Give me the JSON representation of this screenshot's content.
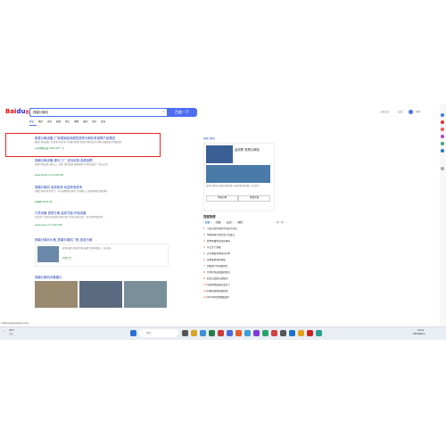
{
  "header": {
    "logo_text": "Bai",
    "logo_du": "du",
    "logo_suffix": "百度",
    "query": "铁磨分离机",
    "search_button": "百度一下",
    "top_links": [
      "百度首页",
      "设置",
      "小",
      "秋秋"
    ]
  },
  "tabs": [
    "网页",
    "图片",
    "资讯",
    "视频",
    "笔记",
    "地图",
    "贴吧",
    "文库",
    "更多"
  ],
  "results": [
    {
      "title": "磁铁分离设备_厂家直销高效磁性铁质分离机有保障产品原因",
      "desc": "磁铁分离设备厂家直销,专业生产各类分离机,铁质分离机选型咨询,质量保障,价格优惠...",
      "source": "兴海电器设备 2024-06",
      "tag": "广告"
    },
    {
      "title": "铁磨分离设备-源头工厂-支持定制-品质保障",
      "desc": "铁磨分离设备,源头工厂直供,支持定制,品质保障,专业研发生产,售后无忧...",
      "source": "www.fenliji.com 2024-06"
    },
    {
      "title": "铁磨分离机 高效除铁 欢迎来电咨询",
      "desc": "铁磨分离机专业生产厂家,高效除铁,适用于各类矿石,欢迎来电咨询选购...",
      "source": "机械网 2024-06"
    },
    {
      "title": "口意设备 铁质分离 高效节能 环保设备",
      "desc": "专业生产铁质分离设备,高效节能,环保,质量可靠,厂家直销价格优惠...",
      "source": "www.jixie.com 2024-06"
    },
    {
      "title": "铁磨分离机价格_铁磨分离机厂家_批发价格",
      "desc": "提供铁磨分离机价格,铁磨分离机批发,厂家直销...",
      "source": "阿里巴巴"
    },
    {
      "title": "铁磨分离机设备图片",
      "desc": "",
      "source": ""
    }
  ],
  "right_panel": {
    "heading": "铁磨分离机",
    "product_title": "金双联 铁屑分离机",
    "desc": "铁屑分离机,高效分离铁屑与切削液,金双联厂家直供...",
    "buttons": [
      "查看官网",
      "在线咨询"
    ],
    "hot_heading": "百度热搜",
    "hot_tabs": [
      "热搜",
      "文娱",
      "民生",
      "财经"
    ],
    "hot_refresh": "换一换",
    "hot_items": [
      "习近平给中国科学院院士回信",
      "中国在联合国大会上的发言",
      "夏季防暑降温注意事项",
      "今日天气预报",
      "高考成绩查询时间公布",
      "某地发布暴雨预警",
      "新能源汽车销量增长",
      "世界杯预选赛最新赛况",
      "航天员出舱活动成功",
      "全国各地迎来高温天气",
      "科技创新成果发布会",
      "2024年经济数据发布"
    ]
  },
  "status_url": "https://www.baidu.com",
  "taskbar": {
    "weather": "28°C",
    "weather_desc": "多云",
    "search_placeholder": "搜索",
    "time": "14:22",
    "date": "2024/6/12"
  }
}
